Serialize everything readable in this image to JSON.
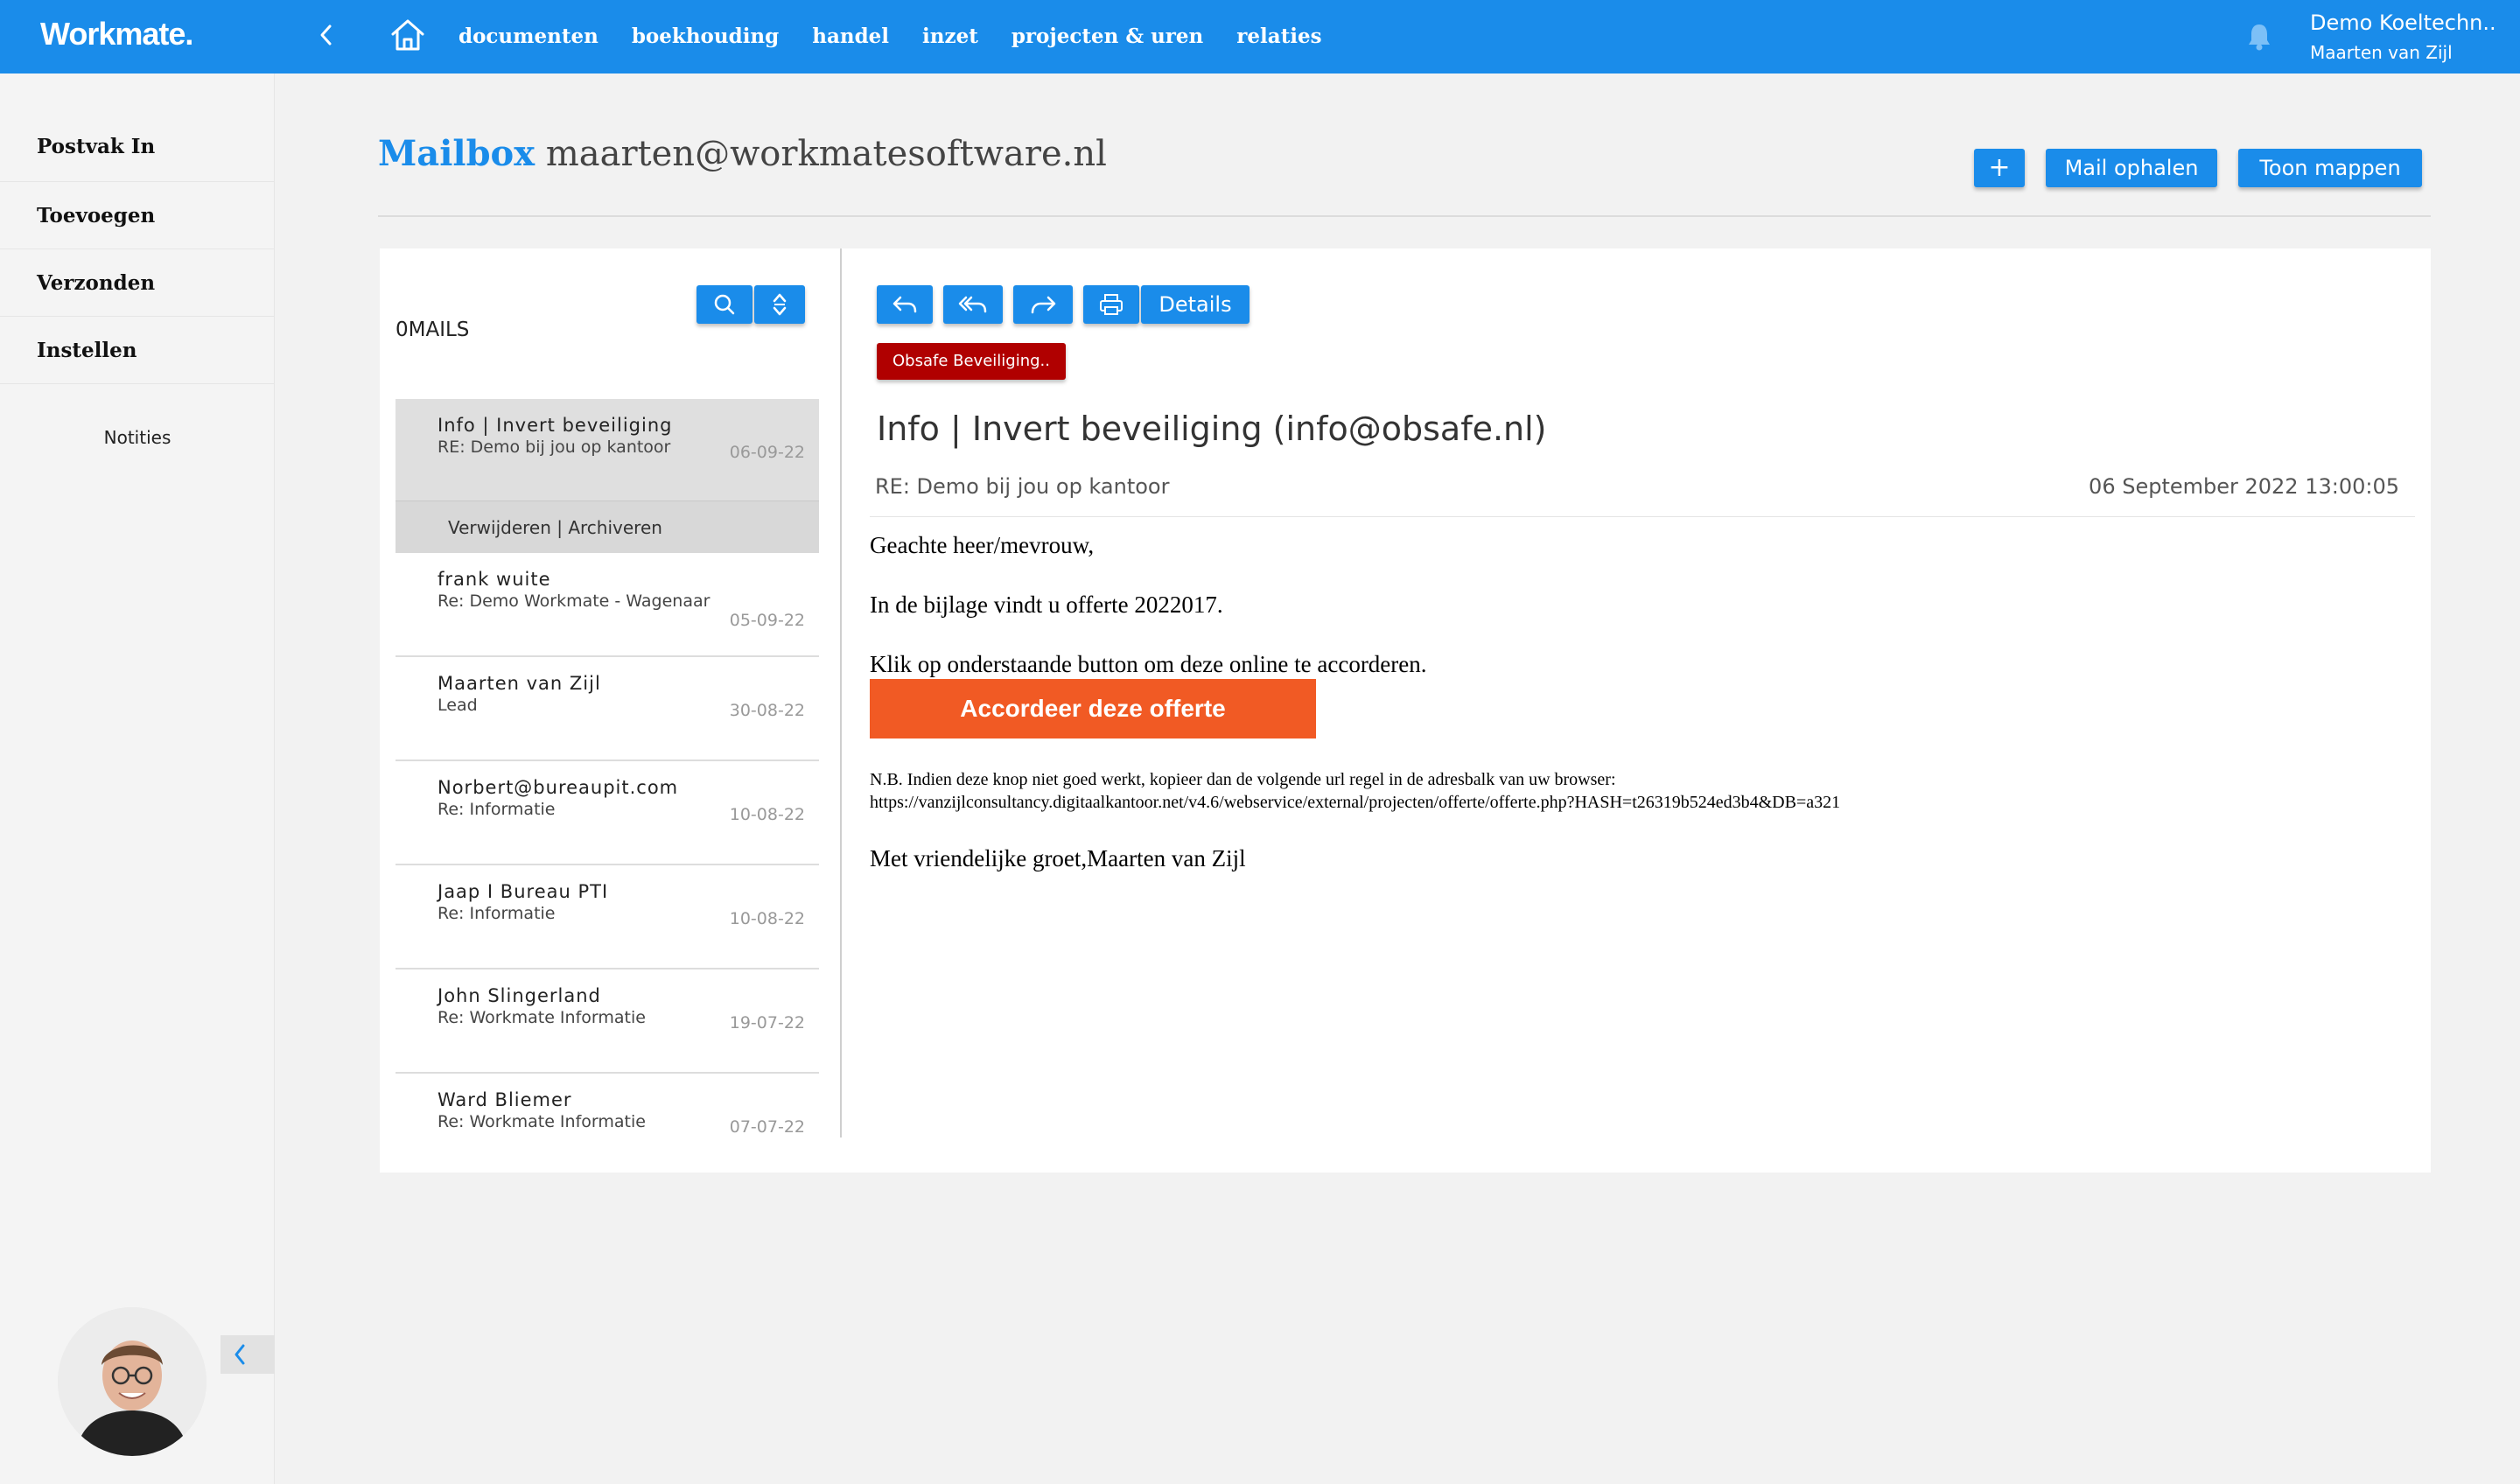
{
  "topbar": {
    "logo": "Workmate.",
    "nav": [
      "documenten",
      "boekhouding",
      "handel",
      "inzet",
      "projecten & uren",
      "relaties"
    ],
    "company": "Demo Koeltechn..",
    "user": "Maarten van Zijl"
  },
  "sidebar": {
    "items": [
      "Postvak In",
      "Toevoegen",
      "Verzonden",
      "Instellen"
    ],
    "notes": "Notities"
  },
  "header": {
    "title_prefix": "Mailbox",
    "title_address": "maarten@workmatesoftware.nl",
    "add_label": "+",
    "fetch_label": "Mail ophalen",
    "folders_label": "Toon mappen"
  },
  "list": {
    "count_label": "0MAILS",
    "actions": "Verwijderen | Archiveren",
    "mails": [
      {
        "from": "Info | Invert beveiliging",
        "subject": "RE: Demo bij jou op kantoor",
        "date": "06-09-22"
      },
      {
        "from": "frank wuite",
        "subject": "Re: Demo Workmate - Wagenaar",
        "date": "05-09-22"
      },
      {
        "from": "Maarten van Zijl",
        "subject": "Lead",
        "date": "30-08-22"
      },
      {
        "from": "Norbert@bureaupit.com",
        "subject": "Re: Informatie",
        "date": "10-08-22"
      },
      {
        "from": "Jaap I Bureau PTI",
        "subject": "Re: Informatie",
        "date": "10-08-22"
      },
      {
        "from": "John Slingerland",
        "subject": "Re: Workmate Informatie",
        "date": "19-07-22"
      },
      {
        "from": "Ward Bliemer",
        "subject": "Re: Workmate Informatie",
        "date": "07-07-22"
      }
    ]
  },
  "reader": {
    "details_label": "Details",
    "tag": "Obsafe Beveiliging..",
    "from": "Info | Invert beveiliging (info@obsafe.nl)",
    "subject": "RE: Demo bij jou op kantoor",
    "date": "06 September 2022 13:00:05",
    "greeting": "Geachte heer/mevrouw,",
    "line1": "In de bijlage vindt u offerte 2022017.",
    "line2": "Klik op onderstaande button om deze online te accorderen.",
    "accept_label": "Accordeer deze offerte",
    "note1": "N.B. Indien deze knop niet goed werkt, kopieer dan de volgende url regel in de adresbalk van uw browser:",
    "note2": "https://vanzijlconsultancy.digitaalkantoor.net/v4.6/webservice/external/projecten/offerte/offerte.php?HASH=t26319b524ed3b4&DB=a321",
    "closing": "Met vriendelijke groet,Maarten van Zijl"
  },
  "colors": {
    "primary": "#1a8cea",
    "tag": "#b00000",
    "accept": "#f15a24"
  }
}
